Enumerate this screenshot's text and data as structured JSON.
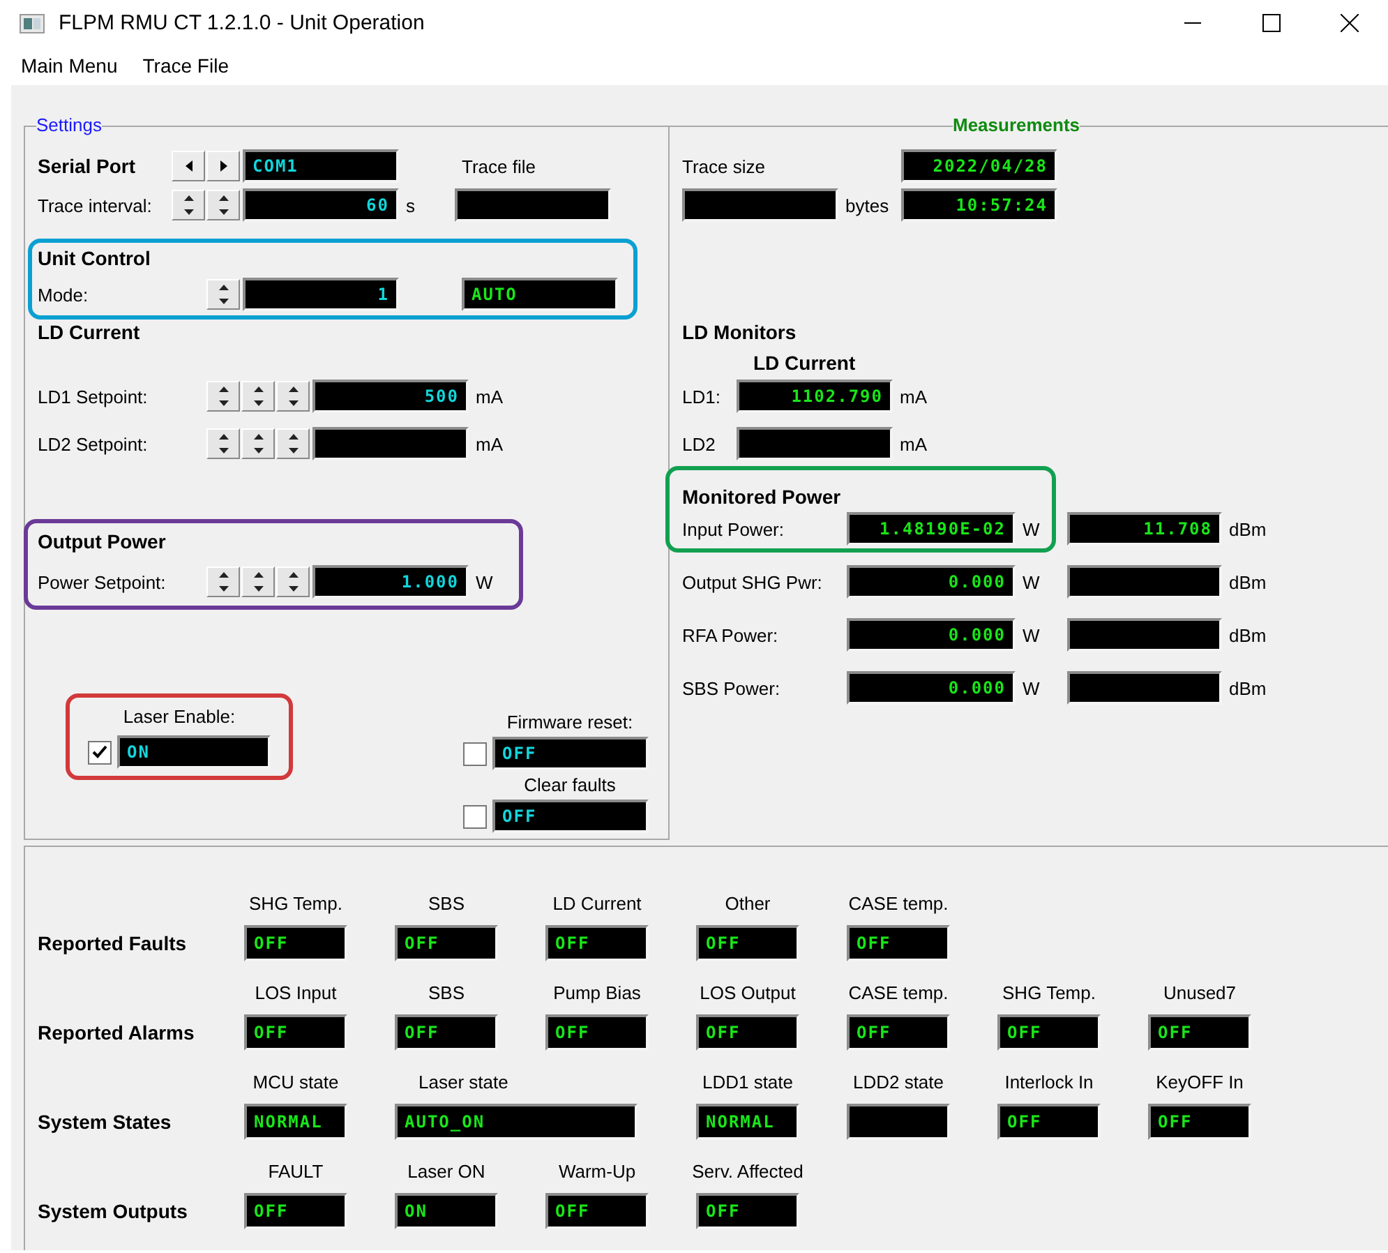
{
  "window": {
    "title": "FLPM RMU CT 1.2.1.0 - Unit Operation"
  },
  "menu": [
    "Main Menu",
    "Trace File"
  ],
  "settings": {
    "legend": "Settings",
    "serial_port": {
      "label": "Serial Port",
      "value": "COM1"
    },
    "trace_file": {
      "label": "Trace file"
    },
    "trace_interval": {
      "label": "Trace interval:",
      "value": "60",
      "unit": "s"
    },
    "unit_control": {
      "title": "Unit Control",
      "color": "#0aa0d2",
      "mode": {
        "label": "Mode:",
        "value": "1",
        "state": "AUTO"
      }
    },
    "ld_current": {
      "title": "LD Current",
      "setpoints": [
        {
          "label": "LD1 Setpoint:",
          "value": "500",
          "unit": "mA"
        },
        {
          "label": "LD2 Setpoint:",
          "unit": "mA"
        }
      ]
    },
    "output_power": {
      "title": "Output Power",
      "color": "#6b3a98",
      "setpoint": {
        "label": "Power Setpoint:",
        "value": "1.000",
        "unit": "W"
      }
    },
    "laser_enable": {
      "label": "Laser Enable:",
      "checked": true,
      "value": "ON",
      "color": "#d2393a"
    },
    "firmware_reset": {
      "label": "Firmware reset:",
      "checked": false,
      "value": "OFF"
    },
    "clear_faults": {
      "label": "Clear faults",
      "checked": false,
      "value": "OFF"
    }
  },
  "measurements": {
    "legend": "Measurements",
    "trace_size": {
      "label": "Trace size",
      "unit": "bytes"
    },
    "date": "2022/04/28",
    "time": "10:57:24",
    "ld_monitors": {
      "title": "LD Monitors",
      "subtitle": "LD Current",
      "rows": [
        {
          "label": "LD1:",
          "value": "1102.790",
          "unit": "mA"
        },
        {
          "label": "LD2",
          "unit": "mA"
        }
      ]
    },
    "monitored_power": {
      "title": "Monitored Power",
      "color": "#12a050",
      "rows": [
        {
          "label": "Input Power:",
          "watts": "1.48190E-02",
          "watt_unit": "W",
          "dbm": "11.708",
          "dbm_unit": "dBm"
        },
        {
          "label": "Output SHG Pwr:",
          "watts": "0.000",
          "watt_unit": "W",
          "dbm_unit": "dBm"
        },
        {
          "label": "RFA Power:",
          "watts": "0.000",
          "watt_unit": "W",
          "dbm_unit": "dBm"
        },
        {
          "label": "SBS Power:",
          "watts": "0.000",
          "watt_unit": "W",
          "dbm_unit": "dBm"
        }
      ]
    }
  },
  "status": [
    {
      "title": "Reported Faults",
      "items": [
        {
          "label": "SHG Temp.",
          "value": "OFF",
          "kind": "normal"
        },
        {
          "label": "SBS",
          "value": "OFF",
          "kind": "normal"
        },
        {
          "label": "LD Current",
          "value": "OFF",
          "kind": "normal"
        },
        {
          "label": "Other",
          "value": "OFF",
          "kind": "normal"
        },
        {
          "label": "CASE temp.",
          "value": "OFF",
          "kind": "normal"
        }
      ]
    },
    {
      "title": "Reported Alarms",
      "items": [
        {
          "label": "LOS Input",
          "value": "OFF",
          "kind": "normal"
        },
        {
          "label": "SBS",
          "value": "OFF",
          "kind": "normal"
        },
        {
          "label": "Pump Bias",
          "value": "OFF",
          "kind": "normal"
        },
        {
          "label": "LOS Output",
          "value": "OFF",
          "kind": "normal"
        },
        {
          "label": "CASE temp.",
          "value": "OFF",
          "kind": "normal"
        },
        {
          "label": "SHG Temp.",
          "value": "OFF",
          "kind": "normal"
        },
        {
          "label": "Unused7",
          "value": "OFF",
          "kind": "normal"
        }
      ]
    },
    {
      "title": "System States",
      "items": [
        {
          "label": "MCU state",
          "value": "NORMAL",
          "kind": "normal"
        },
        {
          "label": "Laser state",
          "value": "AUTO_ON",
          "kind": "wide"
        },
        {
          "label": "LDD1 state",
          "value": "NORMAL",
          "kind": "normal"
        },
        {
          "label": "LDD2 state",
          "kind": "normal"
        },
        {
          "label": "Interlock In",
          "value": "OFF",
          "kind": "normal"
        },
        {
          "label": "KeyOFF In",
          "value": "OFF",
          "kind": "normal"
        }
      ]
    },
    {
      "title": "System Outputs",
      "items": [
        {
          "label": "FAULT",
          "value": "OFF",
          "kind": "normal"
        },
        {
          "label": "Laser ON",
          "value": "ON",
          "kind": "normal"
        },
        {
          "label": "Warm-Up",
          "value": "OFF",
          "kind": "normal"
        },
        {
          "label": "Serv. Affected",
          "value": "OFF",
          "kind": "normal"
        }
      ]
    }
  ]
}
